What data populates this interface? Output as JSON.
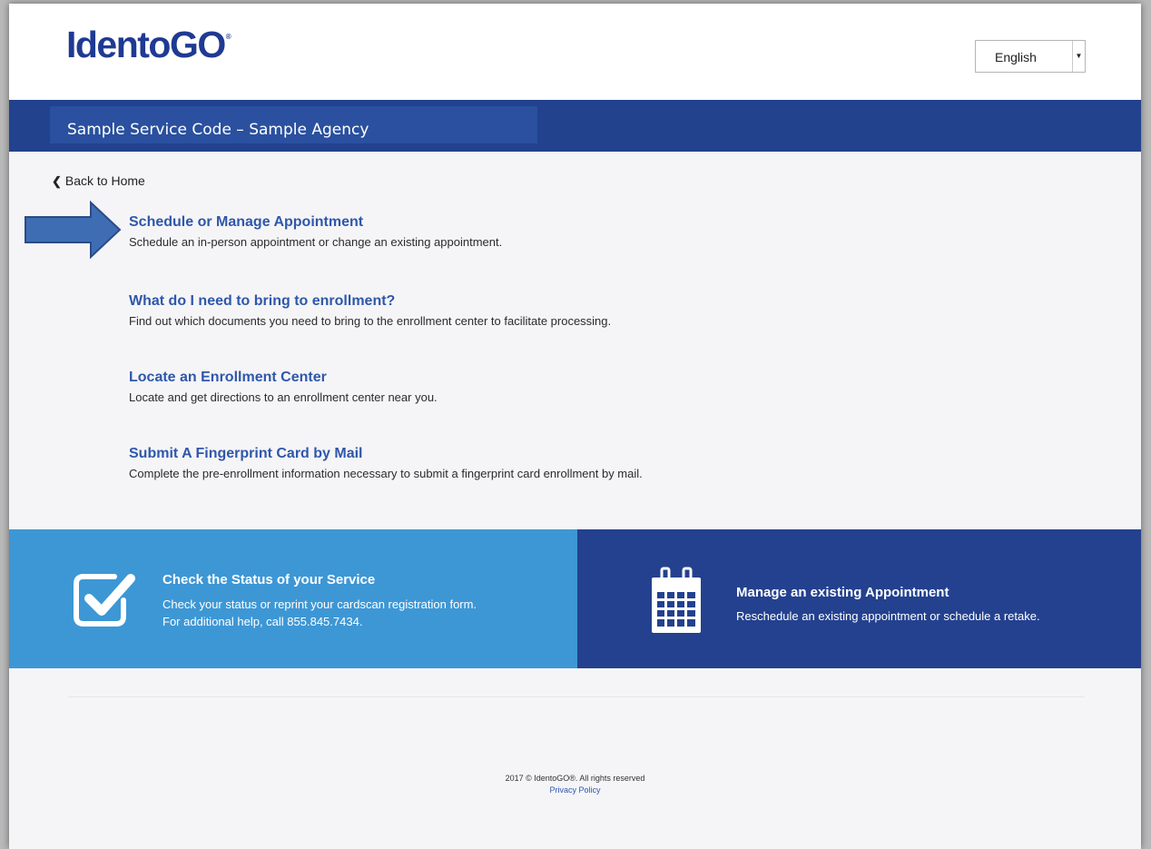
{
  "header": {
    "logo_text": "IdentoGO",
    "logo_mark": "®",
    "language": {
      "selected": "English"
    }
  },
  "banner": {
    "title": "Sample Service Code – Sample Agency"
  },
  "nav": {
    "back_label": "Back to Home",
    "back_icon": "chevron-left-icon"
  },
  "options": [
    {
      "title": "Schedule or Manage Appointment",
      "description": "Schedule an in-person appointment or change an existing appointment."
    },
    {
      "title": "What do I need to bring to enrollment?",
      "description": "Find out which documents you need to bring to the enrollment center to facilitate processing."
    },
    {
      "title": "Locate an Enrollment Center",
      "description": "Locate and get directions to an enrollment center near you."
    },
    {
      "title": "Submit A Fingerprint Card by Mail",
      "description": "Complete the pre-enrollment information necessary to submit a fingerprint card enrollment by mail."
    }
  ],
  "tiles": {
    "status": {
      "icon": "checkbox-icon",
      "title": "Check the Status of your Service",
      "description_line1": "Check your status or reprint your cardscan registration form.",
      "description_line2": "For additional help, call 855.845.7434."
    },
    "manage": {
      "icon": "calendar-icon",
      "title": "Manage an existing Appointment",
      "description": "Reschedule an existing appointment or schedule a retake."
    }
  },
  "footer": {
    "copyright": "2017 © IdentoGO®. All rights reserved",
    "privacy_label": "Privacy Policy"
  },
  "colors": {
    "brand_blue": "#1f3a93",
    "banner_blue": "#22428e",
    "link_blue": "#2f57aa",
    "status_tile": "#3d97d5",
    "manage_tile": "#23418e",
    "pointer_arrow": "#3f6db3"
  }
}
